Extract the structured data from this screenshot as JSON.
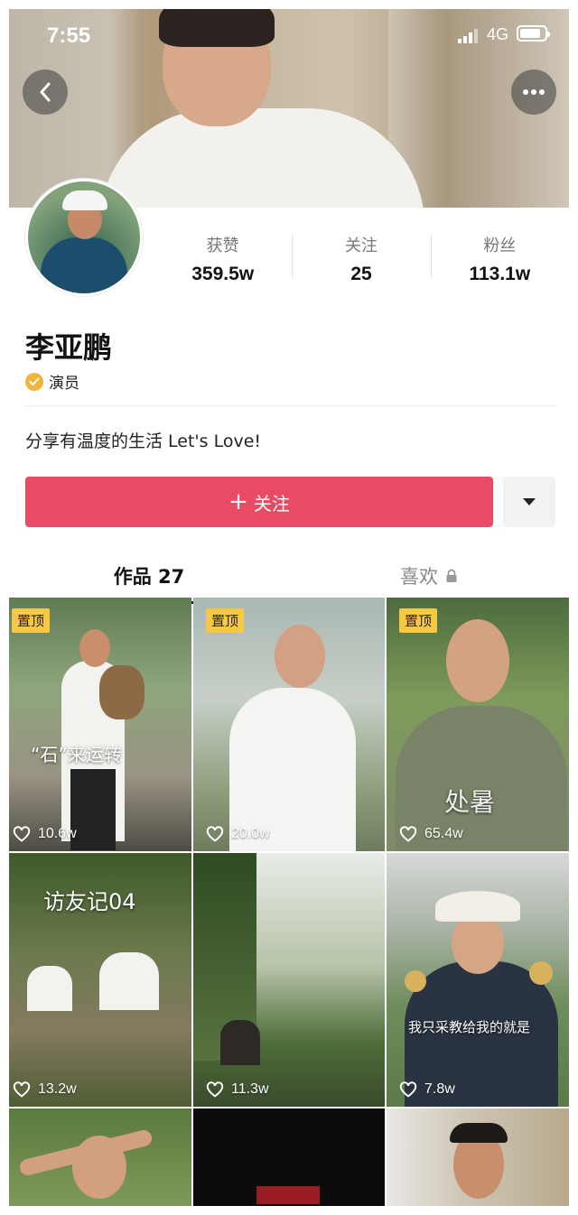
{
  "status": {
    "time": "7:55",
    "network": "4G",
    "battery_level": 0.85
  },
  "profile": {
    "name": "李亚鹏",
    "verification": "演员",
    "bio": "分享有温度的生活 Let's Love!",
    "stats": [
      {
        "label": "获赞",
        "value": "359.5w"
      },
      {
        "label": "关注",
        "value": "25"
      },
      {
        "label": "粉丝",
        "value": "113.1w"
      }
    ]
  },
  "actions": {
    "follow_label": "关注"
  },
  "tabs": {
    "works": "作品 27",
    "likes": "喜欢"
  },
  "videos": [
    {
      "pinned": "置顶",
      "caption": "“石”来运转",
      "likes": "10.6w"
    },
    {
      "pinned": "置顶",
      "caption": "",
      "likes": "20.0w"
    },
    {
      "pinned": "置顶",
      "caption": "处暑",
      "likes": "65.4w"
    },
    {
      "pinned": "",
      "caption": "访友记04",
      "likes": "13.2w"
    },
    {
      "pinned": "",
      "caption": "",
      "likes": "11.3w"
    },
    {
      "pinned": "",
      "caption": "我只采教给我的就是",
      "likes": "7.8w"
    }
  ],
  "colors": {
    "accent": "#ea4b64",
    "pin": "#f6c844"
  }
}
